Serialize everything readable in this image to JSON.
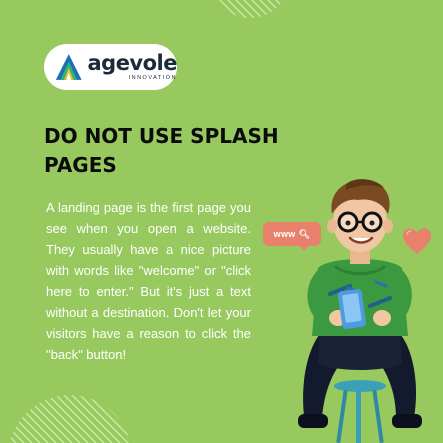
{
  "brand": {
    "name": "agevole",
    "tagline": "INNOVATION"
  },
  "headline": "DO NOT USE SPLASH PAGES",
  "body": "A landing page is the first page you see when you open a website. They usually have a nice picture with words like \"welcome\" or \"click here to enter.\" But it's just a text without a destination. Don't let your visitors have a reason to click the \"back\" button!",
  "bubble": {
    "label": "www",
    "icon": "search-icon"
  },
  "colors": {
    "background": "#97c95f",
    "accent": "#e8806c",
    "headline": "#0b0b0b",
    "body_text": "#ffffff",
    "stripes": "#c6e6a0"
  },
  "decorations": [
    "striped-circle",
    "heart-icon",
    "person-with-phone-illustration"
  ]
}
